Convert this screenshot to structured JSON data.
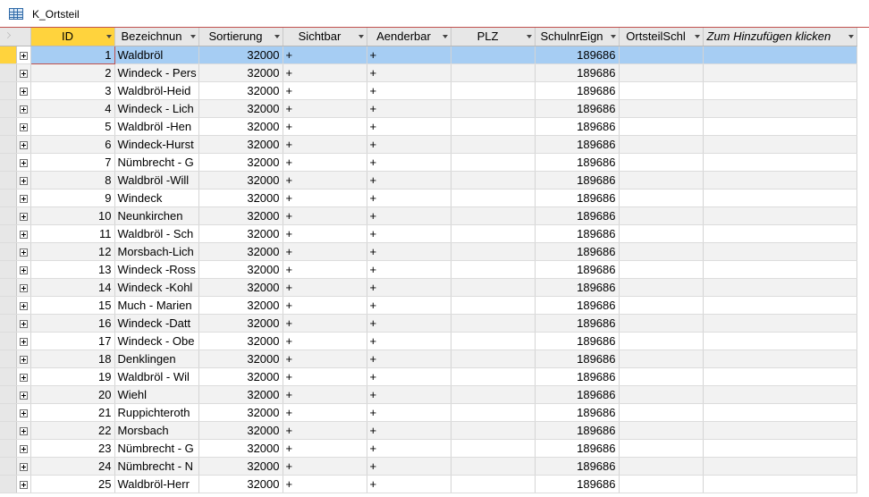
{
  "tab": {
    "title": "K_Ortsteil",
    "icon": "table-icon"
  },
  "columns": [
    {
      "key": "id",
      "label": "ID"
    },
    {
      "key": "bezeichnung",
      "label": "Bezeichnun"
    },
    {
      "key": "sortierung",
      "label": "Sortierung"
    },
    {
      "key": "sichtbar",
      "label": "Sichtbar"
    },
    {
      "key": "aenderbar",
      "label": "Aenderbar"
    },
    {
      "key": "plz",
      "label": "PLZ"
    },
    {
      "key": "schulnr",
      "label": "SchulnrEign"
    },
    {
      "key": "ortsteilschl",
      "label": "OrtsteilSchl"
    },
    {
      "key": "add",
      "label": "Zum Hinzufügen klicken"
    }
  ],
  "current_row": 0,
  "colors": {
    "selected_row": "#a6cdf3",
    "row_selector_active": "#ffd33d",
    "header_bg": "#e7e7e7"
  },
  "rows": [
    {
      "id": "1",
      "bezeichnung": "Waldbröl",
      "sortierung": "32000",
      "sichtbar": "+",
      "aenderbar": "+",
      "plz": "",
      "schulnr": "189686",
      "ortsteilschl": ""
    },
    {
      "id": "2",
      "bezeichnung": "Windeck - Pers",
      "sortierung": "32000",
      "sichtbar": "+",
      "aenderbar": "+",
      "plz": "",
      "schulnr": "189686",
      "ortsteilschl": ""
    },
    {
      "id": "3",
      "bezeichnung": "Waldbröl-Heid",
      "sortierung": "32000",
      "sichtbar": "+",
      "aenderbar": "+",
      "plz": "",
      "schulnr": "189686",
      "ortsteilschl": ""
    },
    {
      "id": "4",
      "bezeichnung": "Windeck - Lich",
      "sortierung": "32000",
      "sichtbar": "+",
      "aenderbar": "+",
      "plz": "",
      "schulnr": "189686",
      "ortsteilschl": ""
    },
    {
      "id": "5",
      "bezeichnung": "Waldbröl -Hen",
      "sortierung": "32000",
      "sichtbar": "+",
      "aenderbar": "+",
      "plz": "",
      "schulnr": "189686",
      "ortsteilschl": ""
    },
    {
      "id": "6",
      "bezeichnung": "Windeck-Hurst",
      "sortierung": "32000",
      "sichtbar": "+",
      "aenderbar": "+",
      "plz": "",
      "schulnr": "189686",
      "ortsteilschl": ""
    },
    {
      "id": "7",
      "bezeichnung": "Nümbrecht - G",
      "sortierung": "32000",
      "sichtbar": "+",
      "aenderbar": "+",
      "plz": "",
      "schulnr": "189686",
      "ortsteilschl": ""
    },
    {
      "id": "8",
      "bezeichnung": "Waldbröl -Will",
      "sortierung": "32000",
      "sichtbar": "+",
      "aenderbar": "+",
      "plz": "",
      "schulnr": "189686",
      "ortsteilschl": ""
    },
    {
      "id": "9",
      "bezeichnung": "Windeck",
      "sortierung": "32000",
      "sichtbar": "+",
      "aenderbar": "+",
      "plz": "",
      "schulnr": "189686",
      "ortsteilschl": ""
    },
    {
      "id": "10",
      "bezeichnung": "Neunkirchen",
      "sortierung": "32000",
      "sichtbar": "+",
      "aenderbar": "+",
      "plz": "",
      "schulnr": "189686",
      "ortsteilschl": ""
    },
    {
      "id": "11",
      "bezeichnung": "Waldbröl - Sch",
      "sortierung": "32000",
      "sichtbar": "+",
      "aenderbar": "+",
      "plz": "",
      "schulnr": "189686",
      "ortsteilschl": ""
    },
    {
      "id": "12",
      "bezeichnung": "Morsbach-Lich",
      "sortierung": "32000",
      "sichtbar": "+",
      "aenderbar": "+",
      "plz": "",
      "schulnr": "189686",
      "ortsteilschl": ""
    },
    {
      "id": "13",
      "bezeichnung": "Windeck -Ross",
      "sortierung": "32000",
      "sichtbar": "+",
      "aenderbar": "+",
      "plz": "",
      "schulnr": "189686",
      "ortsteilschl": ""
    },
    {
      "id": "14",
      "bezeichnung": "Windeck -Kohl",
      "sortierung": "32000",
      "sichtbar": "+",
      "aenderbar": "+",
      "plz": "",
      "schulnr": "189686",
      "ortsteilschl": ""
    },
    {
      "id": "15",
      "bezeichnung": "Much - Marien",
      "sortierung": "32000",
      "sichtbar": "+",
      "aenderbar": "+",
      "plz": "",
      "schulnr": "189686",
      "ortsteilschl": ""
    },
    {
      "id": "16",
      "bezeichnung": "Windeck -Datt",
      "sortierung": "32000",
      "sichtbar": "+",
      "aenderbar": "+",
      "plz": "",
      "schulnr": "189686",
      "ortsteilschl": ""
    },
    {
      "id": "17",
      "bezeichnung": "Windeck - Obe",
      "sortierung": "32000",
      "sichtbar": "+",
      "aenderbar": "+",
      "plz": "",
      "schulnr": "189686",
      "ortsteilschl": ""
    },
    {
      "id": "18",
      "bezeichnung": "Denklingen",
      "sortierung": "32000",
      "sichtbar": "+",
      "aenderbar": "+",
      "plz": "",
      "schulnr": "189686",
      "ortsteilschl": ""
    },
    {
      "id": "19",
      "bezeichnung": "Waldbröl - Wil",
      "sortierung": "32000",
      "sichtbar": "+",
      "aenderbar": "+",
      "plz": "",
      "schulnr": "189686",
      "ortsteilschl": ""
    },
    {
      "id": "20",
      "bezeichnung": "Wiehl",
      "sortierung": "32000",
      "sichtbar": "+",
      "aenderbar": "+",
      "plz": "",
      "schulnr": "189686",
      "ortsteilschl": ""
    },
    {
      "id": "21",
      "bezeichnung": "Ruppichteroth",
      "sortierung": "32000",
      "sichtbar": "+",
      "aenderbar": "+",
      "plz": "",
      "schulnr": "189686",
      "ortsteilschl": ""
    },
    {
      "id": "22",
      "bezeichnung": "Morsbach",
      "sortierung": "32000",
      "sichtbar": "+",
      "aenderbar": "+",
      "plz": "",
      "schulnr": "189686",
      "ortsteilschl": ""
    },
    {
      "id": "23",
      "bezeichnung": "Nümbrecht - G",
      "sortierung": "32000",
      "sichtbar": "+",
      "aenderbar": "+",
      "plz": "",
      "schulnr": "189686",
      "ortsteilschl": ""
    },
    {
      "id": "24",
      "bezeichnung": "Nümbrecht - N",
      "sortierung": "32000",
      "sichtbar": "+",
      "aenderbar": "+",
      "plz": "",
      "schulnr": "189686",
      "ortsteilschl": ""
    },
    {
      "id": "25",
      "bezeichnung": "Waldbröl-Herr",
      "sortierung": "32000",
      "sichtbar": "+",
      "aenderbar": "+",
      "plz": "",
      "schulnr": "189686",
      "ortsteilschl": ""
    }
  ]
}
